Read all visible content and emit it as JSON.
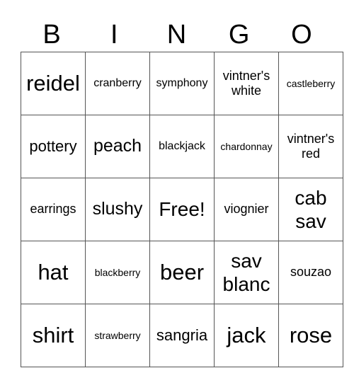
{
  "header": [
    "B",
    "I",
    "N",
    "G",
    "O"
  ],
  "rows": [
    [
      "reidel",
      "cranberry",
      "symphony",
      "vintner's white",
      "castleberry"
    ],
    [
      "pottery",
      "peach",
      "blackjack",
      "chardonnay",
      "vintner's red"
    ],
    [
      "earrings",
      "slushy",
      "Free!",
      "viognier",
      "cab sav"
    ],
    [
      "hat",
      "blackberry",
      "beer",
      "sav blanc",
      "souzao"
    ],
    [
      "shirt",
      "strawberry",
      "sangria",
      "jack",
      "rose"
    ]
  ]
}
